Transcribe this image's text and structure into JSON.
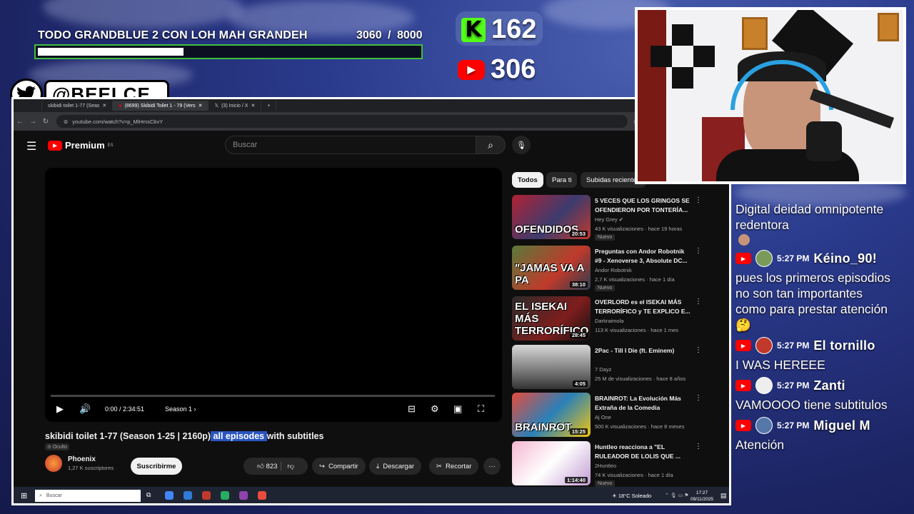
{
  "goal": {
    "title": "TODO GRANDBLUE 2 CON LOH MAH GRANDEH",
    "current": "3060",
    "separator": "/",
    "target": "8000",
    "progress_fraction": 0.3825
  },
  "counters": {
    "kick_count": "162",
    "youtube_count": "306",
    "kick_icon": "kick-logo-icon",
    "youtube_icon": "youtube-logo-icon"
  },
  "twitter": {
    "handle": "@BEELCE_",
    "icon": "twitter-bird-icon"
  },
  "browser": {
    "tabs": [
      "skibidi toilet 1-77 (Seas",
      "(8699) Skibidi Toilet 1 - 79 (Vers",
      "(3) Inicio / X"
    ],
    "url": "youtube.com/watch?v=p_MlHmsCbvY"
  },
  "youtube": {
    "brand": "Premium",
    "region": "ES",
    "search_placeholder": "Buscar",
    "player": {
      "time": "0:00 / 2:34:51",
      "chapter": "Season 1",
      "chapter_chevron": "›",
      "progress_fraction": 0.0
    },
    "video": {
      "title_pre": "skibidi toilet 1-77 (Season 1-25 | 2160p)",
      "title_highlight": " all episodes ",
      "title_post": "with subtitles",
      "visibility": "Oculto",
      "channel": "Phoenix",
      "subscribers": "1,27 K suscriptores",
      "subscribe_label": "Suscribirme",
      "likes": "823",
      "share_label": "Compartir",
      "download_label": "Descargar",
      "clip_label": "Recortar",
      "more": "···"
    },
    "chips": [
      "Todos",
      "Para ti",
      "Subidas recientes"
    ],
    "recommendations": [
      {
        "title": "5 VECES QUE LOS GRINGOS SE OFENDIERON POR TONTERÍA...",
        "channel": "Hey Grey",
        "meta": "43 K visualizaciones · hace 19 horas",
        "badge": "Nuevo",
        "duration": "20:53",
        "thumb_text": "OFENDIDOS"
      },
      {
        "title": "Preguntas con Andor Robotnik #9 - Xenoverse 3, Absolute DC...",
        "channel": "Andor Robotnik",
        "meta": "2,7 K visualizaciones · hace 1 día",
        "badge": "Nuevo",
        "duration": "38:10",
        "thumb_text": "\"JAMAS VA A PA"
      },
      {
        "title": "OVERLORD es el ISEKAI MÁS TERRORÍFICO y TE EXPLICO E...",
        "channel": "Darkraimola",
        "meta": "113 K visualizaciones · hace 1 mes",
        "badge": "",
        "duration": "28:45",
        "thumb_text": "EL ISEKAI MÁS TERRORÍFICO"
      },
      {
        "title": "2Pac - Till I Die (ft. Eminem)",
        "channel": "7 Dayz",
        "meta": "25 M de visualizaciones · hace 8 años",
        "badge": "",
        "duration": "4:05",
        "thumb_text": ""
      },
      {
        "title": "BRAINROT: La Evolución Más Extraña de la Comedia",
        "channel": "Aj One",
        "meta": "500 K visualizaciones · hace 8 meses",
        "badge": "",
        "duration": "15:25",
        "thumb_text": "BRAINROT"
      },
      {
        "title": "Huntleo reacciona a \"EL RULEADOR DE LOLIS QUE ...",
        "channel": "2Huntleo",
        "meta": "74 K visualizaciones · hace 1 día",
        "badge": "Nuevo",
        "duration": "1:14:40",
        "thumb_text": ""
      }
    ]
  },
  "taskbar": {
    "search": "Buscar",
    "weather": "18°C  Soleado",
    "time": "17:27",
    "date": "09/11/2025"
  },
  "chat": {
    "first_message": "Digital deidad omnipotente redentora",
    "messages": [
      {
        "time": "5:27 PM",
        "user": "Kéino_90!",
        "text": "pues los primeros episodios no son tan importantes como para prestar atención 🤔"
      },
      {
        "time": "5:27 PM",
        "user": "El tornillo",
        "text": "I WAS HEREEE"
      },
      {
        "time": "5:27 PM",
        "user": "Zanti",
        "text": "VAMOOOO tiene subtitulos"
      },
      {
        "time": "5:27 PM",
        "user": "Miguel M",
        "text": "Atención"
      }
    ]
  },
  "colors": {
    "kick_green": "#53fc18",
    "youtube_red": "#ff0000",
    "goal_border": "#3fbf3f",
    "highlight": "#2a55c0"
  }
}
